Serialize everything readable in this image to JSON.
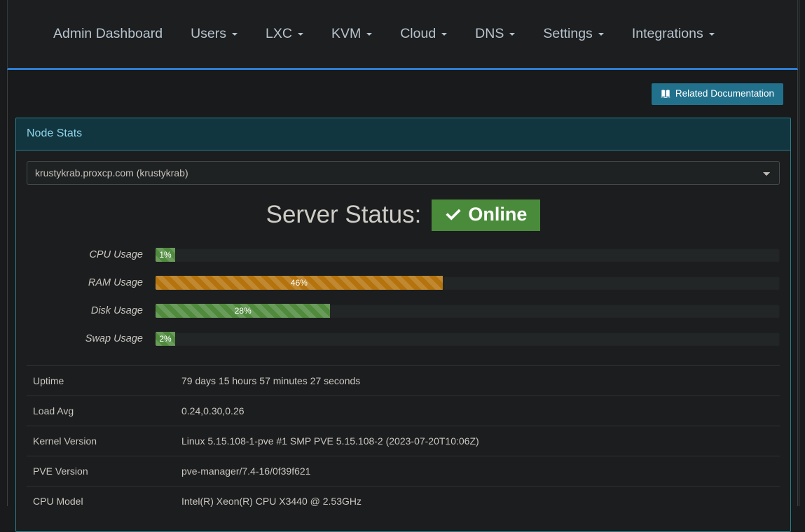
{
  "navbar": {
    "brand": "Admin Dashboard",
    "items": [
      {
        "label": "Users",
        "caret": true
      },
      {
        "label": "LXC",
        "caret": true
      },
      {
        "label": "KVM",
        "caret": true
      },
      {
        "label": "Cloud",
        "caret": true
      },
      {
        "label": "DNS",
        "caret": true
      },
      {
        "label": "Settings",
        "caret": true
      },
      {
        "label": "Integrations",
        "caret": true
      }
    ],
    "accent_color": "#2d7dd2"
  },
  "toolbar": {
    "doc_button_label": "Related Documentation",
    "doc_button_icon": "book-icon",
    "doc_button_color": "#21718d"
  },
  "panel": {
    "title": "Node Stats",
    "border_color": "#2b7f8d",
    "heading_bg": "#113640"
  },
  "node_select": {
    "selected": "krustykrab.proxcp.com (krustykrab)",
    "options": [
      "krustykrab.proxcp.com (krustykrab)"
    ]
  },
  "server_status": {
    "label": "Server Status:",
    "value": "Online",
    "icon": "check-icon",
    "badge_color": "#4a8b3b"
  },
  "usage": [
    {
      "label": "CPU Usage",
      "value": 1,
      "text": "1%",
      "style": "bar-success",
      "color": "#4f8a3d"
    },
    {
      "label": "RAM Usage",
      "value": 46,
      "text": "46%",
      "style": "bar-warning",
      "color": "#b4730d"
    },
    {
      "label": "Disk Usage",
      "value": 28,
      "text": "28%",
      "style": "bar-success",
      "color": "#4f8a3d"
    },
    {
      "label": "Swap Usage",
      "value": 2,
      "text": "2%",
      "style": "bar-success",
      "color": "#4f8a3d"
    }
  ],
  "info": [
    {
      "key": "Uptime",
      "value": "79 days 15 hours 57 minutes 27 seconds"
    },
    {
      "key": "Load Avg",
      "value": "0.24,0.30,0.26"
    },
    {
      "key": "Kernel Version",
      "value": "Linux 5.15.108-1-pve #1 SMP PVE 5.15.108-2 (2023-07-20T10:06Z)"
    },
    {
      "key": "PVE Version",
      "value": "pve-manager/7.4-16/0f39f621"
    },
    {
      "key": "CPU Model",
      "value": "Intel(R) Xeon(R) CPU X3440 @ 2.53GHz"
    }
  ]
}
